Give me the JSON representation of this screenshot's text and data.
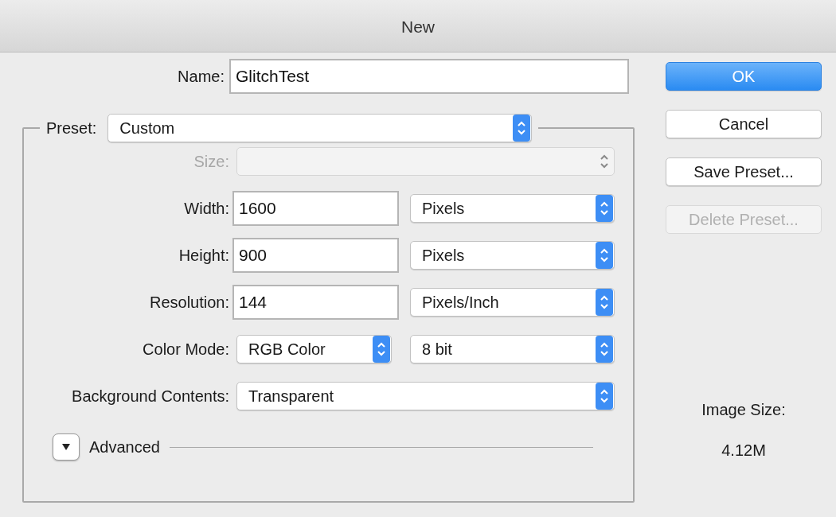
{
  "window": {
    "title": "New"
  },
  "name": {
    "label": "Name:",
    "value": "GlitchTest"
  },
  "preset": {
    "label": "Preset:",
    "value": "Custom"
  },
  "rows": [
    {
      "label": "Size:",
      "disabled": true,
      "fields": [
        {
          "kind": "popup",
          "disabled": true
        }
      ]
    },
    {
      "label": "Width:",
      "disabled": false,
      "fields": [
        {
          "kind": "input",
          "value": "1600"
        },
        {
          "kind": "popup",
          "value": "Pixels",
          "disabled": false
        }
      ]
    },
    {
      "label": "Height:",
      "disabled": false,
      "fields": [
        {
          "kind": "input",
          "value": "900"
        },
        {
          "kind": "popup",
          "value": "Pixels",
          "disabled": false
        }
      ]
    },
    {
      "label": "Resolution:",
      "disabled": false,
      "fields": [
        {
          "kind": "input",
          "value": "144"
        },
        {
          "kind": "popup",
          "value": "Pixels/Inch",
          "disabled": false
        }
      ]
    },
    {
      "label": "Color Mode:",
      "disabled": false,
      "fields": [
        {
          "kind": "popup",
          "value": "RGB Color",
          "disabled": false
        },
        {
          "kind": "popup",
          "value": "8 bit",
          "disabled": false
        }
      ]
    },
    {
      "label": "Background Contents:",
      "disabled": false,
      "fields": [
        {
          "kind": "popup",
          "value": "Transparent",
          "disabled": false
        }
      ]
    }
  ],
  "advanced": {
    "label": "Advanced",
    "expanded": false
  },
  "buttons": [
    {
      "label": "OK",
      "default": true,
      "disabled": false
    },
    {
      "label": "Cancel",
      "default": false,
      "disabled": false
    },
    {
      "label": "Save Preset...",
      "default": false,
      "disabled": false
    },
    {
      "label": "Delete Preset...",
      "default": false,
      "disabled": true
    }
  ],
  "image_size": {
    "label": "Image Size:",
    "value": "4.12M"
  }
}
